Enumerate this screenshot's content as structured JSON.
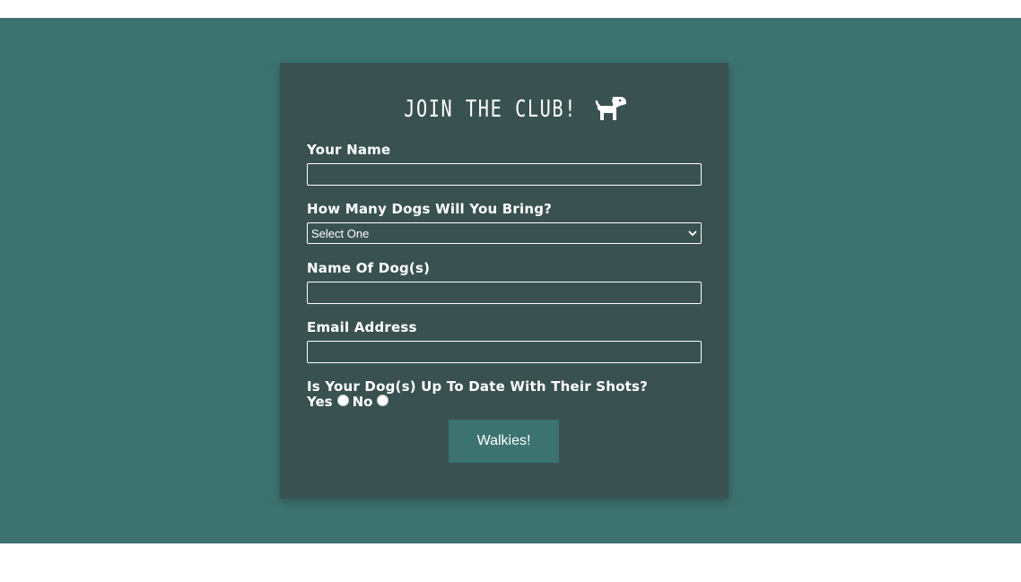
{
  "form": {
    "title": "JOIN THE CLUB!",
    "icon": "dog-icon",
    "fields": {
      "name": {
        "label": "Your Name",
        "value": ""
      },
      "dog_count": {
        "label": "How Many Dogs Will You Bring?",
        "selected": "Select One"
      },
      "dog_names": {
        "label": "Name Of Dog(s)",
        "value": ""
      },
      "email": {
        "label": "Email Address",
        "value": ""
      },
      "shots": {
        "label": "Is Your Dog(s) Up To Date With Their Shots?",
        "options": [
          "Yes",
          "No"
        ]
      }
    },
    "submit_label": "Walkies!"
  },
  "colors": {
    "background": "#3c7370",
    "card": "#3a5151",
    "text": "#ffffff",
    "button": "#3c7370"
  }
}
